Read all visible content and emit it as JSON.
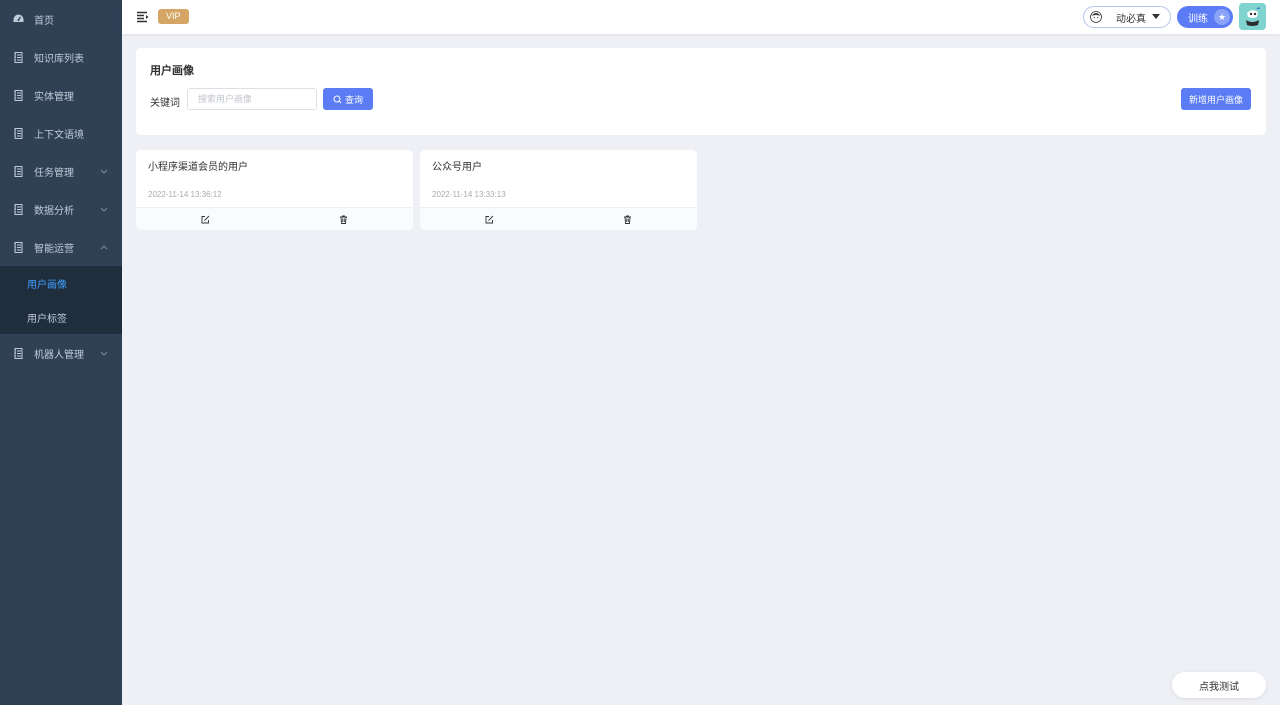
{
  "sidebar": {
    "items": [
      {
        "label": "首页",
        "icon": "dashboard-icon"
      },
      {
        "label": "知识库列表",
        "icon": "document-icon"
      },
      {
        "label": "实体管理",
        "icon": "document-icon"
      },
      {
        "label": "上下文语境",
        "icon": "document-icon"
      },
      {
        "label": "任务管理",
        "icon": "document-icon",
        "arrow": "down"
      },
      {
        "label": "数据分析",
        "icon": "document-icon",
        "arrow": "down"
      },
      {
        "label": "智能运营",
        "icon": "document-icon",
        "arrow": "up"
      },
      {
        "label": "机器人管理",
        "icon": "document-icon",
        "arrow": "down"
      }
    ],
    "submenu": [
      {
        "label": "用户画像",
        "active": true
      },
      {
        "label": "用户标签",
        "active": false
      }
    ]
  },
  "header": {
    "vip_label": "VIP",
    "user_name": "动必真",
    "train_label": "训练",
    "star": "★"
  },
  "main": {
    "title": "用户画像",
    "keyword_label": "关键词",
    "search_placeholder": "搜索用户画像",
    "query_label": "查询",
    "add_label": "新增用户画像"
  },
  "cards": [
    {
      "title": "小程序渠道会员的用户",
      "time": "2022-11-14 13:36:12"
    },
    {
      "title": "公众号用户",
      "time": "2022-11-14 13:33:13"
    }
  ],
  "test_label": "点我测试",
  "colors": {
    "sidebar_bg": "#304156",
    "submenu_bg": "#1f2d3d",
    "primary": "#5b7cf4",
    "active_text": "#409eff",
    "vip": "#d4a564",
    "page_bg": "#eef0f5"
  }
}
